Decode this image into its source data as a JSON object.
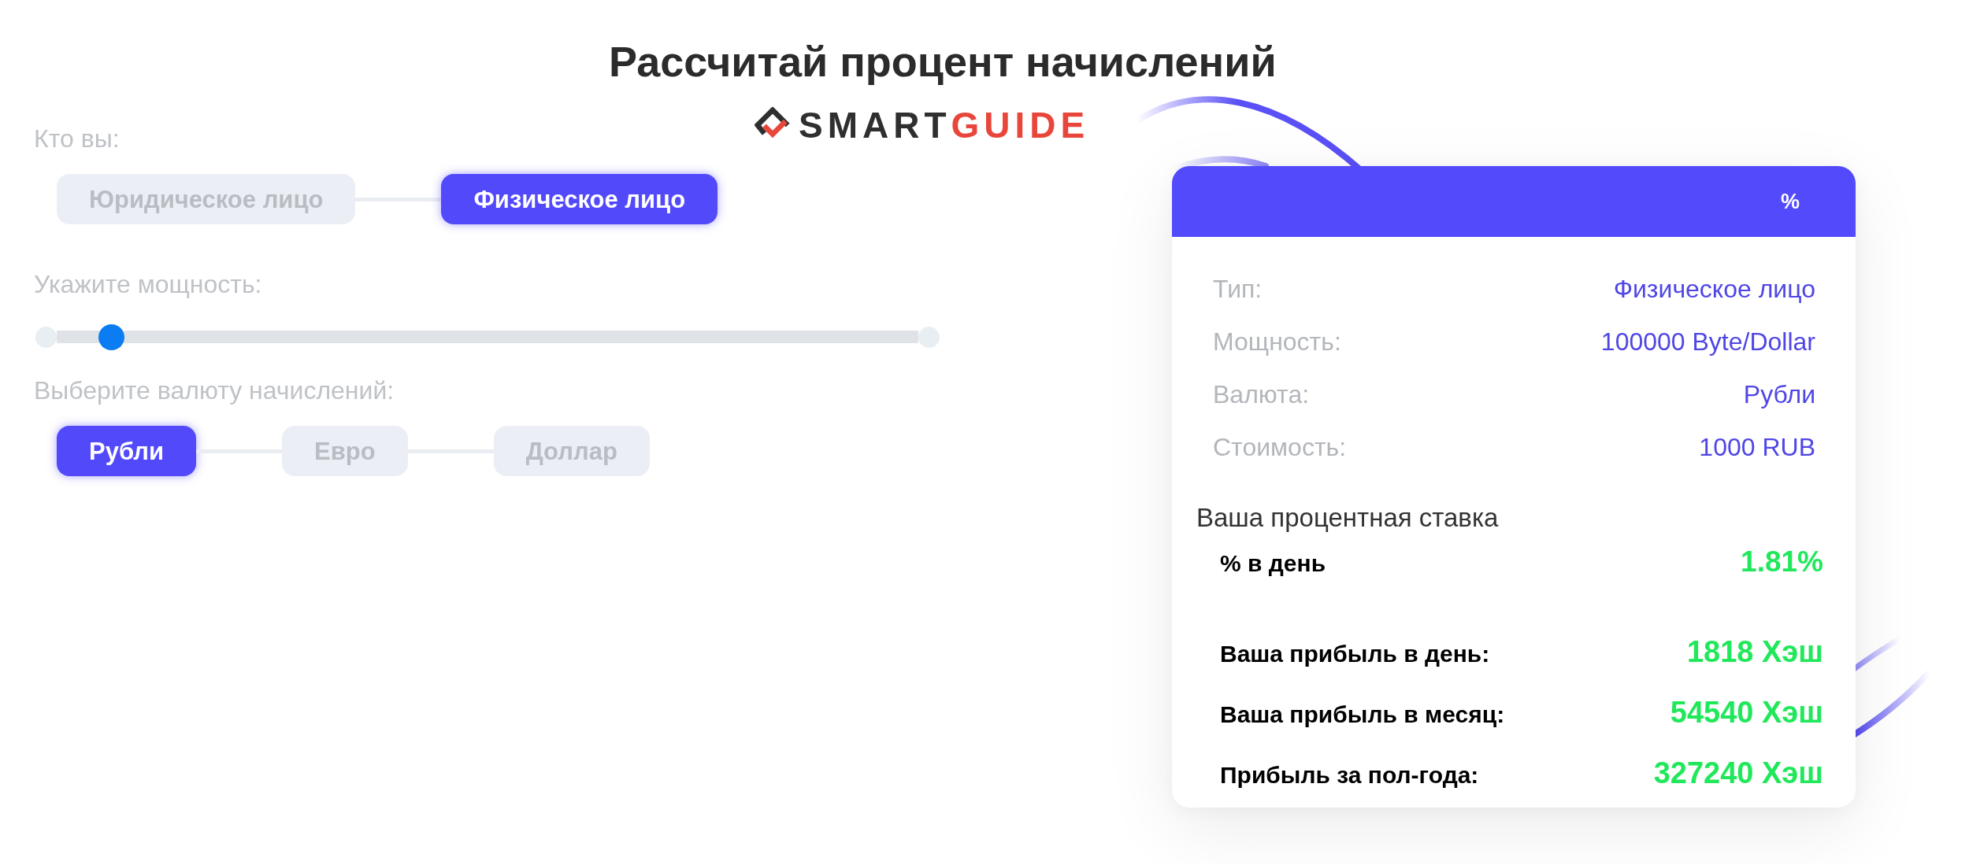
{
  "header": {
    "title": "Рассчитай процент начислений",
    "logo": {
      "parts": [
        {
          "text": "SMART",
          "color": "#2f2f2f"
        },
        {
          "text": "GUIDE",
          "color": "#e8463b"
        }
      ]
    }
  },
  "who": {
    "label": "Кто вы:",
    "options": [
      {
        "label": "Юридическое лицо",
        "selected": false
      },
      {
        "label": "Физическое лицо",
        "selected": true
      }
    ]
  },
  "power": {
    "label": "Укажите мощность:",
    "slider": {
      "level": 0.05
    }
  },
  "currency": {
    "label": "Выберите валюту начислений:",
    "options": [
      {
        "label": "Рубли",
        "selected": true
      },
      {
        "label": "Евро",
        "selected": false
      },
      {
        "label": "Доллар",
        "selected": false
      }
    ]
  },
  "result_card": {
    "header": "%",
    "details": [
      {
        "label": "Тип:",
        "value": "Физическое лицо"
      },
      {
        "label": "Мощность:",
        "value": "100000 Byte/Dollar"
      },
      {
        "label": "Валюта:",
        "value": "Рубли"
      },
      {
        "label": "Стоимость:",
        "value": "1000 RUB"
      }
    ],
    "rate_heading": "Ваша процентная ставка",
    "rate": {
      "label": "% в день",
      "value": "1.81%"
    },
    "profits": [
      {
        "label": "Ваша прибыль в день:",
        "value": "1818 Хэш"
      },
      {
        "label": "Ваша прибыль в месяц:",
        "value": "54540 Хэш"
      },
      {
        "label": "Прибыль за пол-года:",
        "value": "327240 Хэш"
      }
    ]
  }
}
